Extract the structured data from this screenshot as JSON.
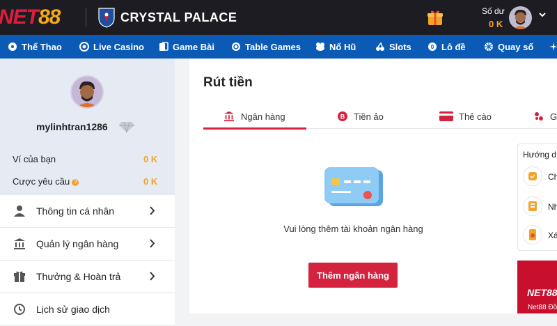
{
  "brand": {
    "logo_part1": "NET",
    "logo_part2": "88",
    "club": "CRYSTAL PALACE"
  },
  "header": {
    "balance_label": "Số dư",
    "balance_value": "0 K",
    "icons": [
      "gift-icon",
      "user-avatar",
      "chevron-down-icon"
    ]
  },
  "nav": {
    "items": [
      {
        "label": "Thể Thao",
        "icon": "sports-ball-icon"
      },
      {
        "label": "Live Casino",
        "icon": "live-casino-icon"
      },
      {
        "label": "Game Bài",
        "icon": "playing-cards-icon"
      },
      {
        "label": "Table Games",
        "icon": "table-games-icon"
      },
      {
        "label": "Nổ Hũ",
        "icon": "jackpot-icon"
      },
      {
        "label": "Slots",
        "icon": "slots-icon"
      },
      {
        "label": "Lô đề",
        "icon": "lottery-icon"
      },
      {
        "label": "Quay số",
        "icon": "wheel-icon"
      }
    ]
  },
  "sidebar": {
    "username": "mylinhtran1286",
    "wallet_label": "Ví của bạn",
    "wallet_value": "0 K",
    "bet_label": "Cược yêu cầu",
    "bet_value": "0 K",
    "menu": [
      {
        "label": "Thông tin cá nhân",
        "icon": "user-icon"
      },
      {
        "label": "Quản lý ngân hàng",
        "icon": "bank-icon"
      },
      {
        "label": "Thưởng & Hoàn trả",
        "icon": "gift-icon"
      },
      {
        "label": "Lịch sử giao dịch",
        "icon": "history-icon"
      }
    ]
  },
  "main": {
    "title": "Rút tiền",
    "tabs": [
      {
        "label": "Ngân hàng",
        "icon": "bank-icon",
        "active": true
      },
      {
        "label": "Tiền ảo",
        "icon": "crypto-coin-icon",
        "active": false
      },
      {
        "label": "Thẻ cào",
        "icon": "scratch-card-icon",
        "active": false
      },
      {
        "label": "G",
        "icon": "more-icon",
        "active": false
      }
    ],
    "empty_message": "Vui lòng thêm tài khoản ngân hàng",
    "add_button": "Thêm ngân hàng"
  },
  "guide": {
    "title": "Hướng d",
    "steps": [
      "Ch",
      "Nh",
      "Xá"
    ]
  },
  "promo": {
    "logo": "NET88",
    "text": "Net88 Đồ"
  },
  "colors": {
    "accent": "#d4233f",
    "nav": "#0b5bb6",
    "topbar": "#1c1c22",
    "gold": "#f3a32b"
  }
}
